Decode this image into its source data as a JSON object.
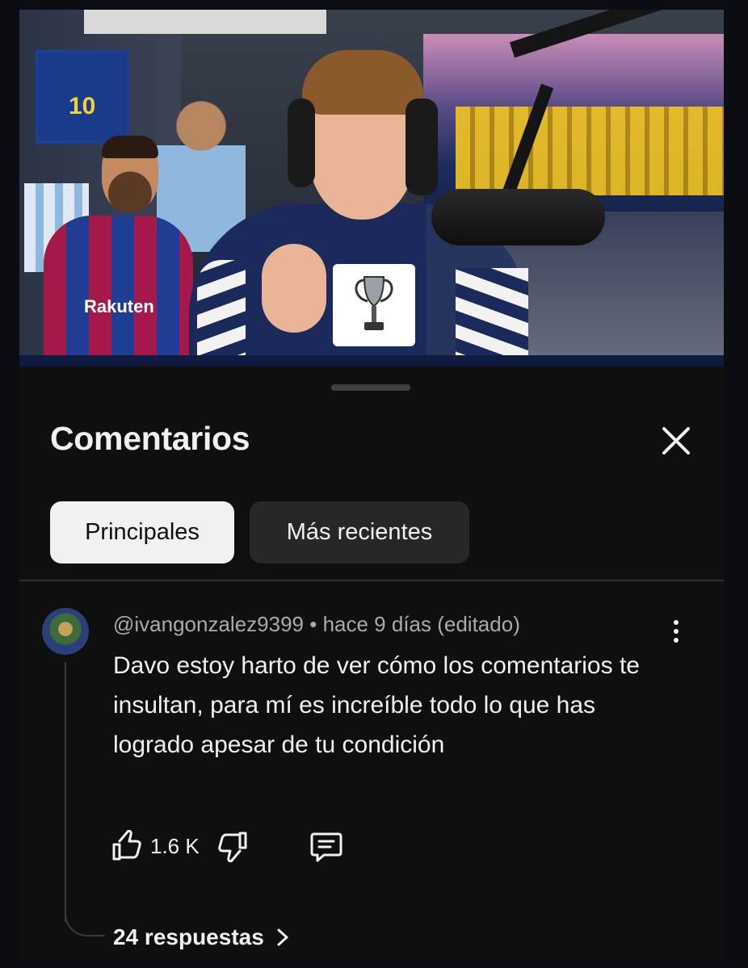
{
  "sheet": {
    "title": "Comentarios",
    "filters": [
      {
        "label": "Principales",
        "selected": true
      },
      {
        "label": "Más recientes",
        "selected": false
      }
    ]
  },
  "comment": {
    "author": "@ivangonzalez9399",
    "separator": " • ",
    "time": "hace 9 días (editado)",
    "text": "Davo estoy harto de ver cómo los comentarios te insultan, para mí es increíble todo lo que has logrado apesar de tu condición",
    "likes": "1.6 K",
    "replies_label": "24 respuestas"
  },
  "video": {
    "jersey_number": "10",
    "sponsor": "Rakuten"
  },
  "icons": {
    "close": "close-icon",
    "more": "more-vert-icon",
    "like": "thumbs-up-icon",
    "dislike": "thumbs-down-icon",
    "reply": "comment-icon",
    "chevron": "chevron-right-icon"
  },
  "colors": {
    "background": "#0f0f0f",
    "text_primary": "#f1f1f1",
    "text_secondary": "#aaaaaa",
    "chip_active_bg": "#f1f1f1",
    "chip_inactive_bg": "#272727"
  }
}
